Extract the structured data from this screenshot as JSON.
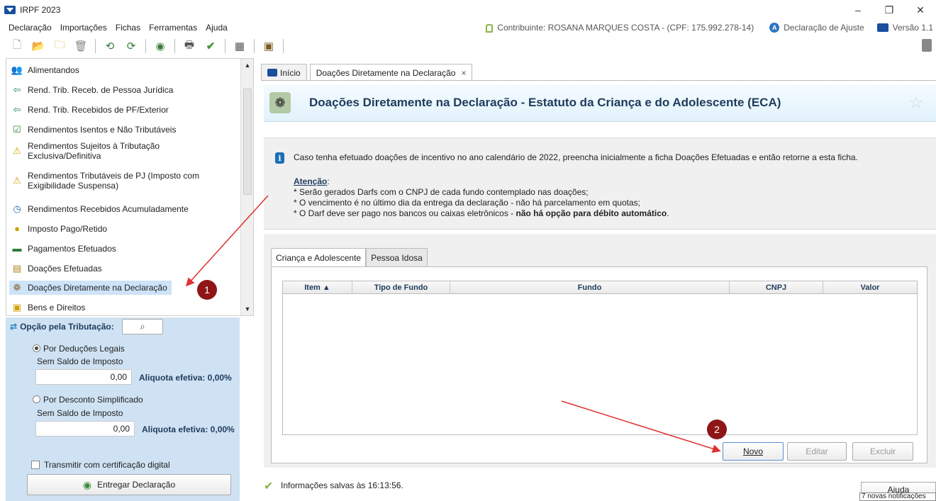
{
  "window": {
    "title": "IRPF 2023",
    "minimize_glyph": "–",
    "restore_glyph": "❐",
    "close_glyph": "✕"
  },
  "menu": [
    "Declaração",
    "Importações",
    "Fichas",
    "Ferramentas",
    "Ajuda"
  ],
  "status": {
    "contribuinte": "Contribuinte: ROSANA MARQUES COSTA - (CPF: 175.992.278-14)",
    "declaracao": "Declaração de Ajuste",
    "versao": "Versão 1.1"
  },
  "toolbar_icons": [
    "new-file-icon",
    "open-folder-icon",
    "folder-icon",
    "trash-icon",
    "import-icon",
    "export-icon",
    "receita-icon",
    "print-icon",
    "check-icon",
    "calculator-icon",
    "book-icon",
    "exit-icon"
  ],
  "sidebar": {
    "items": [
      {
        "label": "Alimentandos",
        "icon": "people-icon"
      },
      {
        "label": "Rend. Trib. Receb. de Pessoa Jurídica",
        "icon": "building-arrow-icon"
      },
      {
        "label": "Rend. Trib. Recebidos de PF/Exterior",
        "icon": "person-arrow-icon"
      },
      {
        "label": "Rendimentos Isentos e Não Tributáveis",
        "icon": "doc-check-icon"
      },
      {
        "label": "Rendimentos Sujeitos à Tributação",
        "label2": "Exclusiva/Definitiva",
        "icon": "warning-doc-icon"
      },
      {
        "label": "Rendimentos Tributáveis de PJ (Imposto com",
        "label2": "Exigibilidade Suspensa)",
        "icon": "building-warning-icon"
      },
      {
        "label": "Rendimentos Recebidos Acumuladamente",
        "icon": "doc-clock-icon"
      },
      {
        "label": "Imposto Pago/Retido",
        "icon": "coin-person-icon"
      },
      {
        "label": "Pagamentos Efetuados",
        "icon": "card-icon"
      },
      {
        "label": "Doações Efetuadas",
        "icon": "doc-money-icon"
      },
      {
        "label": "Doações Diretamente na Declaração",
        "icon": "gift-people-icon"
      },
      {
        "label": "Bens e Direitos",
        "icon": "safe-icon"
      }
    ]
  },
  "tax_option": {
    "header": "Opção pela Tributação:",
    "deducoes_label": "Por Deduções Legais",
    "deducoes_saldo": "Sem Saldo de Imposto",
    "deducoes_value": "0,00",
    "deducoes_aliquota": "Aliquota efetiva: 0,00%",
    "simplificado_label": "Por Desconto Simplificado",
    "simplificado_saldo": "Sem Saldo de Imposto",
    "simplificado_value": "0,00",
    "simplificado_aliquota": "Aliquota efetiva: 0,00%",
    "transmitir_label": "Transmitir com certificação digital",
    "entregar_label": "Entregar Declaração"
  },
  "tabs": [
    {
      "label": "Início"
    },
    {
      "label": "Doações Diretamente na Declaração",
      "close": "×"
    }
  ],
  "page": {
    "title": "Doações Diretamente na Declaração - Estatuto da Criança e do Adolescente (ECA)"
  },
  "info": {
    "main": "Caso tenha efetuado doações de incentivo no ano calendário de 2022, preencha inicialmente a ficha Doações Efetuadas e então retorne a esta ficha.",
    "atencao": "Atenção",
    "atencao_colon": ":",
    "bullet1": "* Serão gerados Darfs com o CNPJ de cada fundo contemplado nas doações;",
    "bullet2": "* O vencimento é no último dia da entrega da declaração - não há parcelamento em quotas;",
    "bullet3_prefix": "* O Darf deve ser pago nos bancos ou caixas eletrônicos - ",
    "bullet3_bold": "não há opção para débito automático",
    "bullet3_suffix": "."
  },
  "subtabs": [
    "Criança e Adolescente",
    "Pessoa Idosa"
  ],
  "table": {
    "columns": [
      "Item ▲",
      "Tipo de Fundo",
      "Fundo",
      "CNPJ",
      "Valor"
    ],
    "rows": []
  },
  "buttons": {
    "novo": "Novo",
    "editar": "Editar",
    "excluir": "Excluir",
    "ajuda": "Ajuda"
  },
  "footer": {
    "saved": "Informações salvas às 16:13:56.",
    "notificacoes": "7 novas notificações"
  },
  "annotations": {
    "marker1": "1",
    "marker2": "2"
  },
  "colors": {
    "header_title": "#1f3b5c",
    "marker": "#8f1616",
    "arrow": "#e03030",
    "tax_panel": "#cfe2f3"
  }
}
